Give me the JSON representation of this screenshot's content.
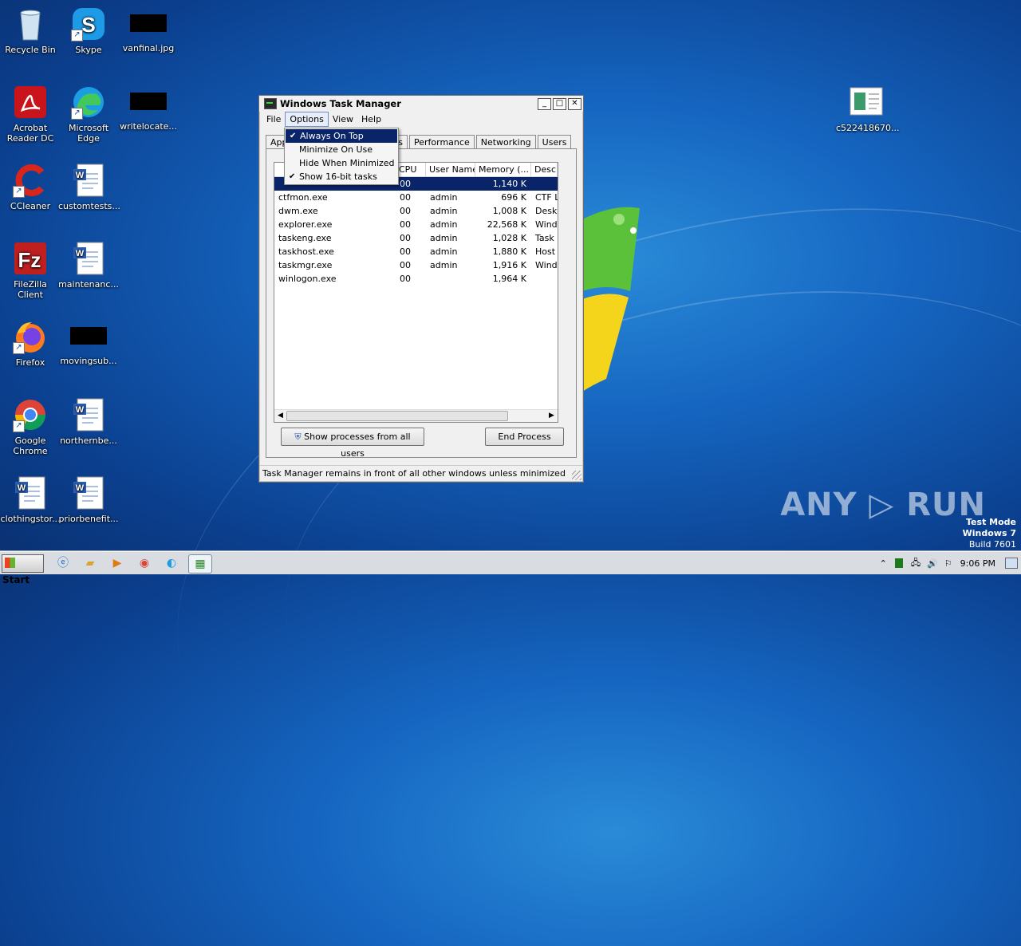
{
  "desktop": {
    "icons": [
      {
        "label": "Recycle Bin",
        "icon": "recycle-bin-icon"
      },
      {
        "label": "Skype",
        "icon": "skype-icon"
      },
      {
        "label": "vanfinal.jpg",
        "icon": "image-file-icon"
      },
      {
        "label": "Acrobat Reader DC",
        "icon": "acrobat-icon"
      },
      {
        "label": "Microsoft Edge",
        "icon": "edge-icon"
      },
      {
        "label": "writelocate...",
        "icon": "file-icon"
      },
      {
        "label": "CCleaner",
        "icon": "ccleaner-icon"
      },
      {
        "label": "customtests...",
        "icon": "word-doc-icon"
      },
      {
        "label": "FileZilla Client",
        "icon": "filezilla-icon"
      },
      {
        "label": "maintenanc...",
        "icon": "word-doc-icon"
      },
      {
        "label": "Firefox",
        "icon": "firefox-icon"
      },
      {
        "label": "movingsub...",
        "icon": "file-icon"
      },
      {
        "label": "Google Chrome",
        "icon": "chrome-icon"
      },
      {
        "label": "northernbe...",
        "icon": "word-doc-icon"
      },
      {
        "label": "clothingstor...",
        "icon": "word-doc-icon"
      },
      {
        "label": "priorbenefit...",
        "icon": "word-doc-icon"
      },
      {
        "label": "c522418670...",
        "icon": "document-icon"
      }
    ]
  },
  "window": {
    "title": "Windows Task Manager",
    "menu": [
      "File",
      "Options",
      "View",
      "Help"
    ],
    "tabs": [
      "App",
      "es",
      "Performance",
      "Networking",
      "Users"
    ],
    "options_menu": [
      {
        "label": "Always On Top",
        "checked": true,
        "highlighted": true
      },
      {
        "label": "Minimize On Use",
        "checked": false
      },
      {
        "label": "Hide When Minimized",
        "checked": false
      },
      {
        "label": "Show 16-bit tasks",
        "checked": true
      }
    ],
    "columns": [
      "",
      "CPU",
      "User Name",
      "Memory (...",
      "Desc"
    ],
    "processes": [
      {
        "name": "",
        "cpu": "00",
        "user": "",
        "memory": "1,140 K",
        "desc": "",
        "selected": true
      },
      {
        "name": "ctfmon.exe",
        "cpu": "00",
        "user": "admin",
        "memory": "696 K",
        "desc": "CTF L"
      },
      {
        "name": "dwm.exe",
        "cpu": "00",
        "user": "admin",
        "memory": "1,008 K",
        "desc": "Desk"
      },
      {
        "name": "explorer.exe",
        "cpu": "00",
        "user": "admin",
        "memory": "22,568 K",
        "desc": "Wind"
      },
      {
        "name": "taskeng.exe",
        "cpu": "00",
        "user": "admin",
        "memory": "1,028 K",
        "desc": "Task"
      },
      {
        "name": "taskhost.exe",
        "cpu": "00",
        "user": "admin",
        "memory": "1,880 K",
        "desc": "Host"
      },
      {
        "name": "taskmgr.exe",
        "cpu": "00",
        "user": "admin",
        "memory": "1,916 K",
        "desc": "Wind"
      },
      {
        "name": "winlogon.exe",
        "cpu": "00",
        "user": "",
        "memory": "1,964 K",
        "desc": ""
      }
    ],
    "show_all_label": "Show processes from all users",
    "end_process_label": "End Process",
    "status": "Task Manager remains in front of all other windows unless minimized"
  },
  "taskbar": {
    "start_label": "Start",
    "clock": "9:06 PM"
  },
  "watermark": {
    "text": "ANY ▷ RUN",
    "line1": "Test Mode",
    "line2": "Windows 7",
    "line3": "Build 7601"
  },
  "colors": {
    "selection": "#0a246a",
    "desktop": "#1565c0"
  }
}
